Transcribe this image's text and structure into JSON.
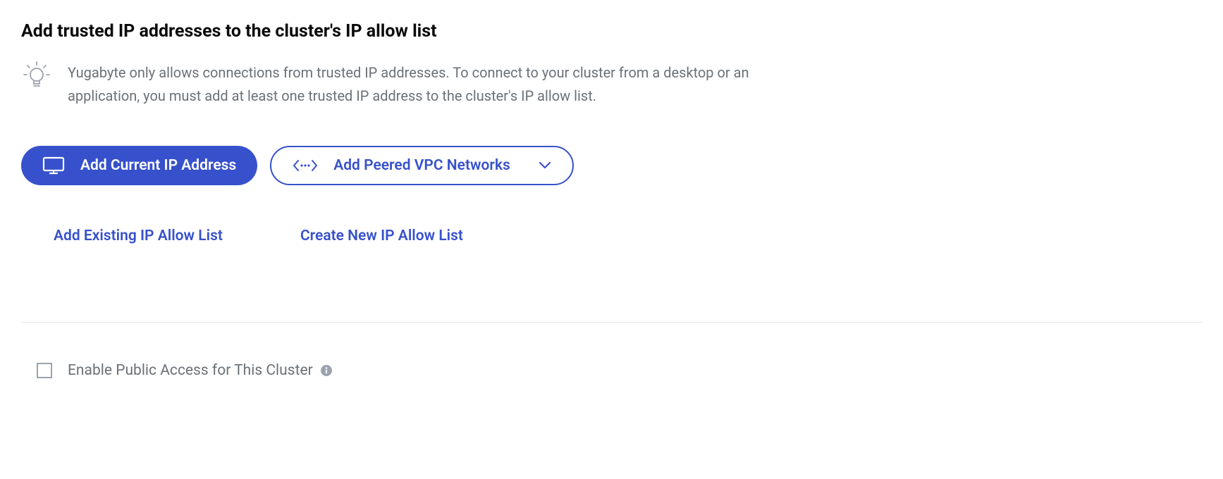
{
  "title": "Add trusted IP addresses to the cluster's IP allow list",
  "info_text": "Yugabyte only allows connections from trusted IP addresses. To connect to your cluster from a desktop or an application, you must add at least one trusted IP address to the cluster's IP allow list.",
  "buttons": {
    "add_current_ip": "Add Current IP Address",
    "add_peered_vpc": "Add Peered VPC Networks"
  },
  "links": {
    "add_existing": "Add Existing IP Allow List",
    "create_new": "Create New IP Allow List"
  },
  "checkbox": {
    "enable_public_access": "Enable Public Access for This Cluster"
  },
  "colors": {
    "primary": "#3751cc",
    "text_muted": "#6b7177"
  }
}
